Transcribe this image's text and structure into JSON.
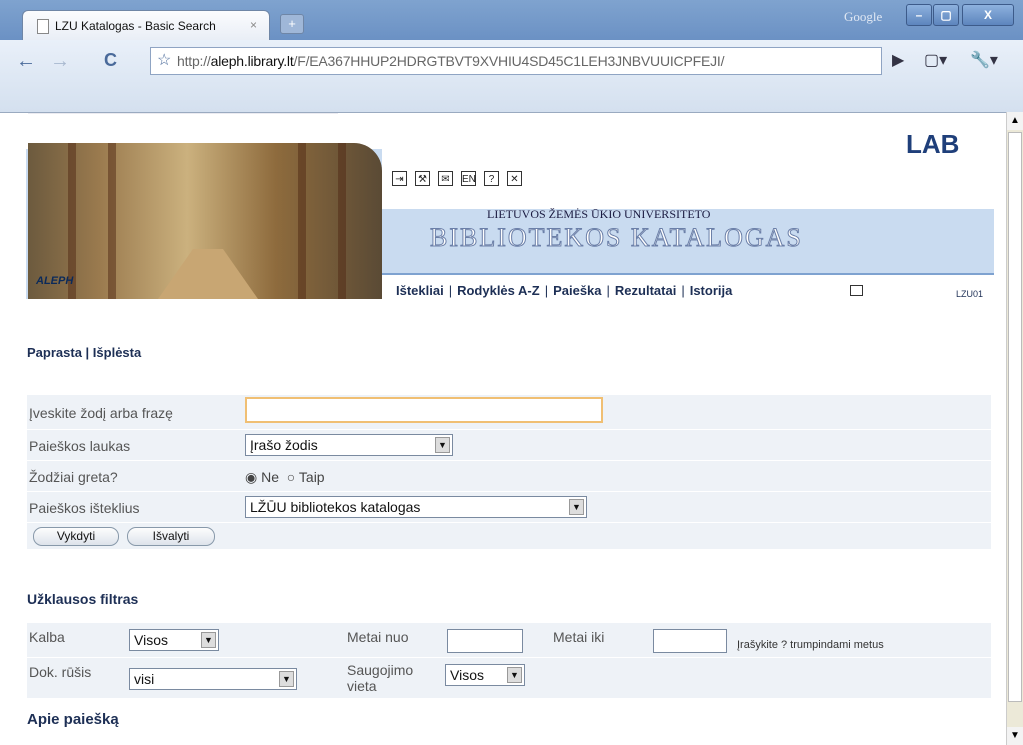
{
  "browser": {
    "tab_title": "LZU Katalogas - Basic Search",
    "tab_close": "×",
    "new_tab": "+",
    "brand": "Google",
    "min": "–",
    "max": "▢",
    "close": "X",
    "url_prefix": "http://",
    "url_host": "aleph.library.lt",
    "url_path": "/F/EA367HHUP2HDRGTBVT9XVHIU4SD45C1LEH3JNBVUUICPFEJI/"
  },
  "header": {
    "logo": "LAB",
    "aleph": "ALEPH",
    "university": "LIETUVOS ŽEMĖS ŪKIO UNIVERSITETO",
    "catalog": "BIBLIOTEKOS KATALOGAS",
    "icon_lang": "EN",
    "icon_help": "?",
    "icon_exit": "✕",
    "menu": [
      "Ištekliai",
      "Rodyklės A-Z",
      "Paieška",
      "Rezultatai",
      "Istorija"
    ],
    "base_code": "LZU01"
  },
  "subnav": {
    "simple": "Paprasta",
    "advanced": "Išplėsta"
  },
  "search": {
    "label_term": "Įveskite žodį arba frazę",
    "term_value": "",
    "label_field": "Paieškos laukas",
    "field_value": "Įrašo žodis",
    "label_adjacent": "Žodžiai greta?",
    "radio_no": "Ne",
    "radio_yes": "Taip",
    "label_resource": "Paieškos išteklius",
    "resource_value": "LŽŪU bibliotekos katalogas",
    "btn_go": "Vykdyti",
    "btn_clear": "Išvalyti"
  },
  "filters": {
    "title": "Užklausos filtras",
    "label_lang": "Kalba",
    "lang_value": "Visos",
    "label_year_from": "Metai nuo",
    "label_year_to": "Metai iki",
    "year_note": "Įrašykite ? trumpindami metus",
    "label_doctype": "Dok. rūšis",
    "doctype_value": "visi",
    "label_location": "Saugojimo vieta",
    "location_value": "Visos"
  },
  "about": "Apie paiešką"
}
